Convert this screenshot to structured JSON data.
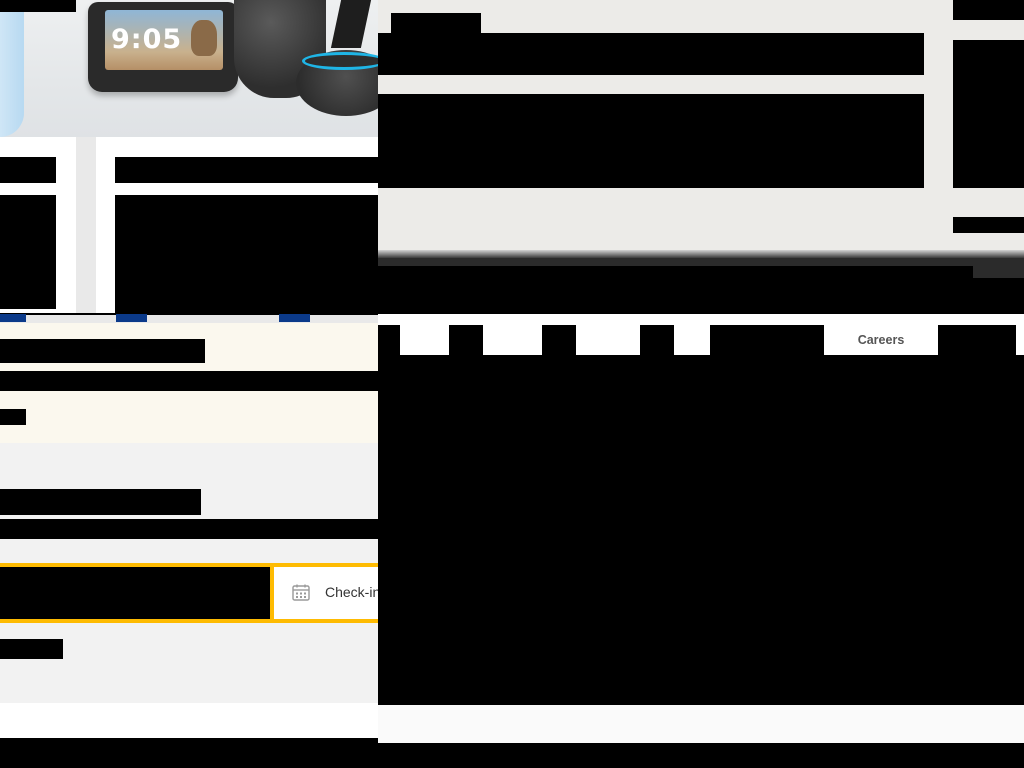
{
  "hero": {
    "device_clock": "9:05"
  },
  "booking": {
    "checkin_label": "Check-in"
  },
  "nav": {
    "careers_label": "Careers"
  },
  "colors": {
    "accent_yellow": "#febb02",
    "nav_tab_blue": "#0b3a8a",
    "notice_cream": "#fbf8ee",
    "echo_ring_cyan": "#1fb5e6"
  },
  "icons": [
    "calendar-icon"
  ]
}
